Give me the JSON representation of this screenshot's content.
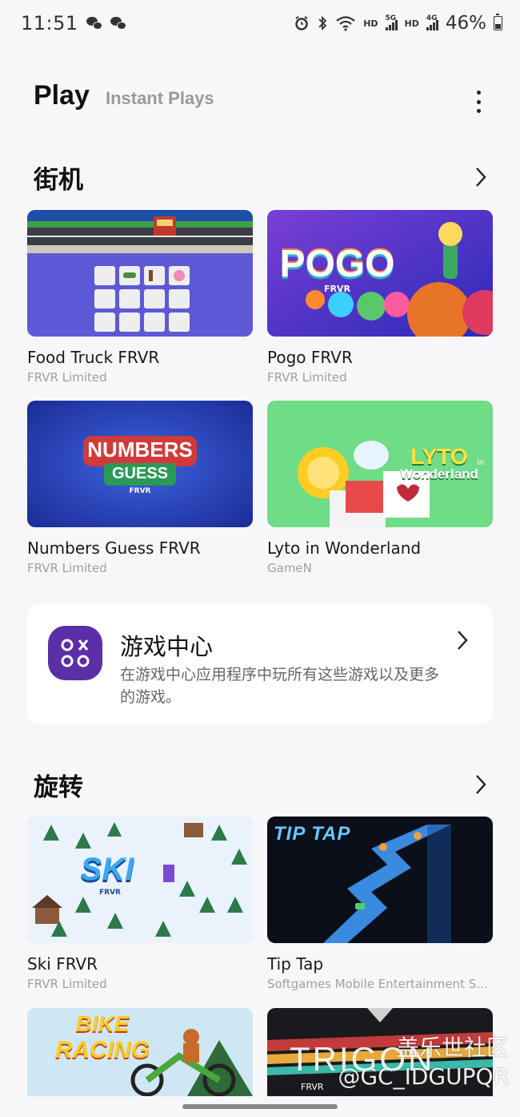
{
  "status_bar": {
    "time": "11:51",
    "hd_label_1": "HD",
    "net_1": "5G",
    "hd_label_2": "HD",
    "net_2": "4G",
    "battery": "46%",
    "battery_level": 0.46
  },
  "header": {
    "title": "Play",
    "subtitle": "Instant Plays"
  },
  "sections": [
    {
      "title": "街机",
      "games": [
        {
          "name": "Food Truck FRVR",
          "developer": "FRVR Limited"
        },
        {
          "name": "Pogo FRVR",
          "developer": "FRVR Limited"
        },
        {
          "name": "Numbers Guess FRVR",
          "developer": "FRVR Limited"
        },
        {
          "name": "Lyto in Wonderland",
          "developer": "GameN"
        }
      ]
    },
    {
      "title": "旋转",
      "games": [
        {
          "name": "Ski FRVR",
          "developer": "FRVR Limited"
        },
        {
          "name": "Tip Tap",
          "developer": "Softgames Mobile Entertainment S…"
        }
      ]
    }
  ],
  "thumbs": {
    "pogo_logo": "POGO",
    "pogo_sub": "FRVR",
    "numbers_line1": "NUMBERS",
    "numbers_line2": "GUESS",
    "numbers_sub": "FRVR",
    "lyto_line1": "LYTO",
    "lyto_in": "in",
    "lyto_line2": "Wonderland",
    "ski_logo": "SKI",
    "ski_sub": "FRVR",
    "tiptap_logo": "TIP TAP",
    "bike_line1": "BIKE",
    "bike_line2": "RACING",
    "trigon_logo": "TRIGON",
    "trigon_sub": "FRVR"
  },
  "game_center": {
    "title": "游戏中心",
    "description": "在游戏中心应用程序中玩所有这些游戏以及更多的游戏。"
  },
  "watermark": {
    "line1": "盖乐世社区",
    "line2": "@GC_IDGUPQR"
  },
  "colors": {
    "game_center_icon_bg": "#5b2fa8",
    "page_bg": "#f7f7f9"
  }
}
